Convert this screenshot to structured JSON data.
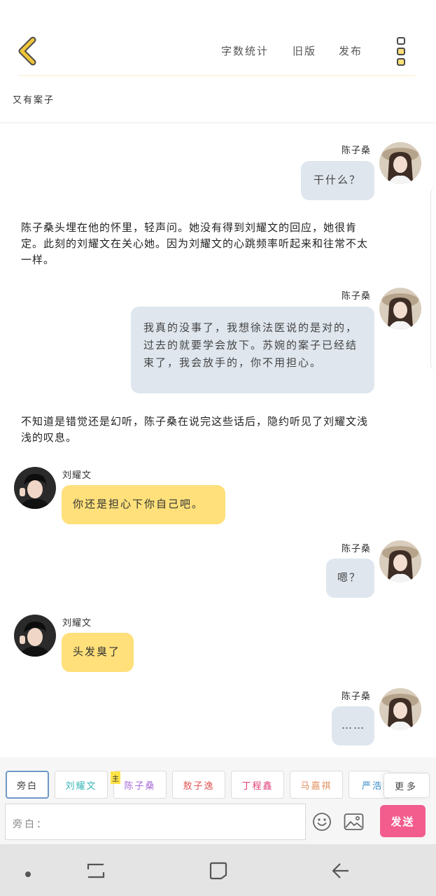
{
  "header": {
    "word_count_label": "字数统计",
    "old_version_label": "旧版",
    "publish_label": "发布"
  },
  "chapter_title": "又有案子",
  "messages": [
    {
      "type": "right",
      "speaker": "陈子桑",
      "text": "干什么？"
    },
    {
      "type": "narration",
      "text": "陈子桑头埋在他的怀里，轻声问。她没有得到刘耀文的回应，她很肯定。此刻的刘耀文在关心她。因为刘耀文的心跳频率听起来和往常不太一样。"
    },
    {
      "type": "right",
      "speaker": "陈子桑",
      "text": "我真的没事了，我想徐法医说的是对的，过去的就要学会放下。苏婉的案子已经结束了，我会放手的，你不用担心。"
    },
    {
      "type": "narration",
      "text": "不知道是错觉还是幻听，陈子桑在说完这些话后，隐约听见了刘耀文浅浅的叹息。"
    },
    {
      "type": "left",
      "speaker": "刘耀文",
      "text": "你还是担心下你自己吧。"
    },
    {
      "type": "right",
      "speaker": "陈子桑",
      "text": "嗯？"
    },
    {
      "type": "left",
      "speaker": "刘耀文",
      "text": "头发臭了"
    },
    {
      "type": "right",
      "speaker": "陈子桑",
      "text": "……"
    }
  ],
  "toolbar": {
    "characters": [
      {
        "label": "旁白",
        "color": "#444444",
        "selected": true
      },
      {
        "label": "刘耀文",
        "color": "#3ab6b6"
      },
      {
        "label": "陈子桑",
        "color": "#a66ad6",
        "badge": "主"
      },
      {
        "label": "敖子逸",
        "color": "#e05555"
      },
      {
        "label": "丁程鑫",
        "color": "#e0407a"
      },
      {
        "label": "马嘉祺",
        "color": "#e09060"
      },
      {
        "label": "严浩翔",
        "color": "#3a8fc9"
      }
    ],
    "more_label": "更多",
    "input_label": "旁白：",
    "input_value": "",
    "send_label": "发送"
  },
  "colors": {
    "accent_yellow": "#ffe07a",
    "right_bubble": "#dfe6ee",
    "send_pink": "#f25d8e",
    "back_arrow": "#f0c53a"
  }
}
